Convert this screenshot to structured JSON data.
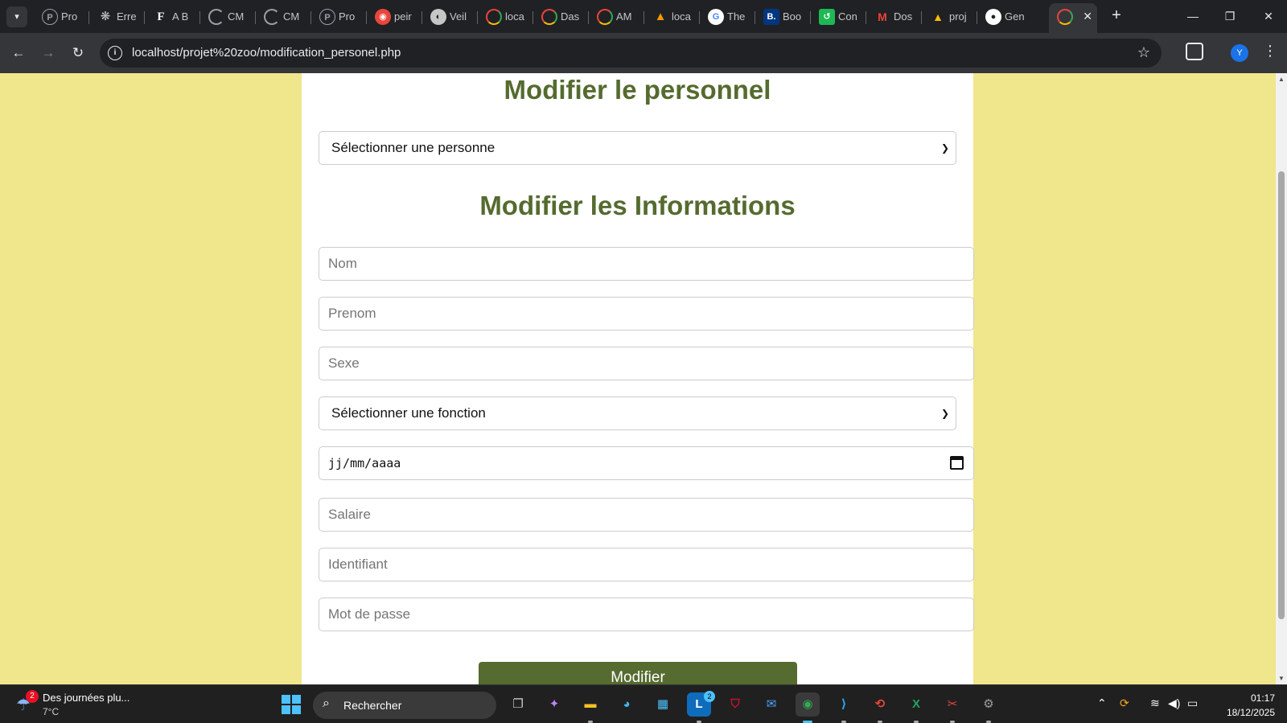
{
  "browser": {
    "tabs": [
      {
        "title": "Pro",
        "icon": "p-icon"
      },
      {
        "title": "Erre",
        "icon": "openai-icon"
      },
      {
        "title": "A B",
        "icon": "f-icon"
      },
      {
        "title": "CM",
        "icon": "loading-icon"
      },
      {
        "title": "CM",
        "icon": "loading-icon"
      },
      {
        "title": "Pro",
        "icon": "p-icon"
      },
      {
        "title": "peir",
        "icon": "paint-icon"
      },
      {
        "title": "Veil",
        "icon": "globe-icon"
      },
      {
        "title": "loca",
        "icon": "app-icon"
      },
      {
        "title": "Das",
        "icon": "app-icon"
      },
      {
        "title": "AM",
        "icon": "app-icon"
      },
      {
        "title": "loca",
        "icon": "pyramid-icon"
      },
      {
        "title": "The",
        "icon": "google-icon"
      },
      {
        "title": "Boo",
        "icon": "booking-icon"
      },
      {
        "title": "Con",
        "icon": "green-app-icon"
      },
      {
        "title": "Dos",
        "icon": "gmail-icon"
      },
      {
        "title": "proj",
        "icon": "drive-icon"
      },
      {
        "title": "Gen",
        "icon": "github-icon"
      },
      {
        "title": "",
        "icon": "app-icon",
        "active": true
      }
    ],
    "close_symbol": "✕",
    "new_tab_symbol": "+",
    "url": "localhost/projet%20zoo/modification_personel.php"
  },
  "page": {
    "title_personnel": "Modifier le personnel",
    "select_person": "Sélectionner une personne",
    "title_informations": "Modifier les Informations",
    "fields": {
      "nom": "Nom",
      "prenom": "Prenom",
      "sexe": "Sexe",
      "fonction": "Sélectionner une fonction",
      "date": "jj/mm/aaaa",
      "salaire": "Salaire",
      "identifiant": "Identifiant",
      "mot_de_passe": "Mot de passe"
    },
    "submit": "Modifier",
    "colors": {
      "background": "#f0e68c",
      "heading": "#556b2f",
      "button": "#556b2f"
    }
  },
  "taskbar": {
    "weather_title": "Des journées plu...",
    "weather_temp": "7°C",
    "weather_badge": "2",
    "search_label": "Rechercher",
    "lens_badge": "2",
    "time": "01:17",
    "date": "18/12/2025"
  }
}
